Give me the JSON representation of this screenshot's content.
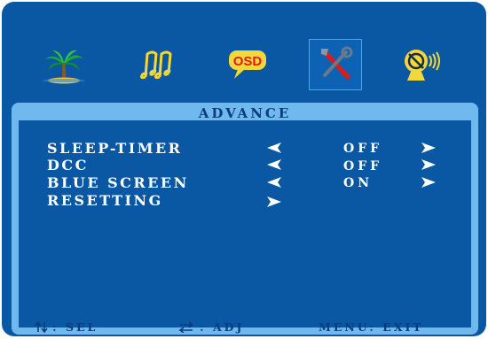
{
  "menu": {
    "icons": [
      {
        "name": "palm-tree-icon",
        "active": false
      },
      {
        "name": "music-note-icon",
        "active": false
      },
      {
        "name": "osd-icon",
        "label": "OSD",
        "active": false
      },
      {
        "name": "tools-icon",
        "active": true
      },
      {
        "name": "satellite-dish-icon",
        "active": false
      }
    ]
  },
  "panel": {
    "title": "ADVANCE",
    "rows": [
      {
        "label": "SLEEP-TIMER",
        "value": "OFF"
      },
      {
        "label": "DCC",
        "value": "OFF"
      },
      {
        "label": "BLUE SCREEN",
        "value": "ON"
      },
      {
        "label": "RESETTING",
        "value": ""
      }
    ]
  },
  "footer": {
    "sel": ": SEL",
    "adj": ": ADJ",
    "exit": "MENU: EXIT"
  },
  "colors": {
    "background": "#0a57a3",
    "panel_frame": "#70b9ee",
    "arrow": "#ffffff",
    "footer_text": "#0b3c7a"
  }
}
